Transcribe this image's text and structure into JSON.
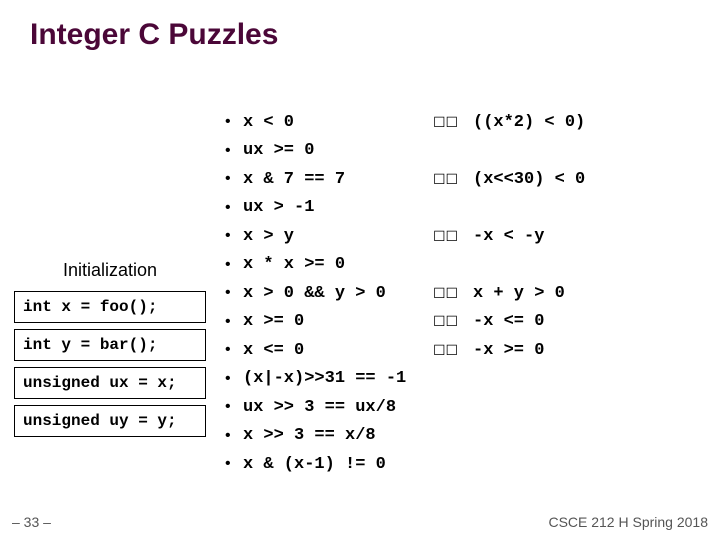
{
  "title": "Integer C Puzzles",
  "left": {
    "heading": "Initialization",
    "lines": [
      "int x = foo();",
      "int y = bar();",
      "unsigned ux = x;",
      "unsigned uy = y;"
    ]
  },
  "arrow_glyph": "☐☐",
  "puzzles": [
    {
      "lhs": "x < 0",
      "has_rhs": true,
      "rhs": "((x*2) < 0)"
    },
    {
      "lhs": "ux >= 0",
      "has_rhs": false,
      "rhs": ""
    },
    {
      "lhs": "x & 7 == 7",
      "has_rhs": true,
      "rhs": "(x<<30) < 0"
    },
    {
      "lhs": "ux > -1",
      "has_rhs": false,
      "rhs": ""
    },
    {
      "lhs": "x > y",
      "has_rhs": true,
      "rhs": "-x < -y"
    },
    {
      "lhs": "x * x >= 0",
      "has_rhs": false,
      "rhs": ""
    },
    {
      "lhs": "x > 0 && y > 0",
      "has_rhs": true,
      "rhs": "x + y > 0"
    },
    {
      "lhs": "x >= 0",
      "has_rhs": true,
      "rhs": "-x <= 0"
    },
    {
      "lhs": "x <= 0",
      "has_rhs": true,
      "rhs": "-x >= 0"
    },
    {
      "lhs": "(x|-x)>>31 == -1",
      "has_rhs": false,
      "rhs": ""
    },
    {
      "lhs": "ux >> 3 == ux/8",
      "has_rhs": false,
      "rhs": ""
    },
    {
      "lhs": "x >> 3 == x/8",
      "has_rhs": false,
      "rhs": ""
    },
    {
      "lhs": "x & (x-1) != 0",
      "has_rhs": false,
      "rhs": ""
    }
  ],
  "footer": {
    "left": "– 33 –",
    "right": "CSCE 212 H Spring 2018"
  }
}
